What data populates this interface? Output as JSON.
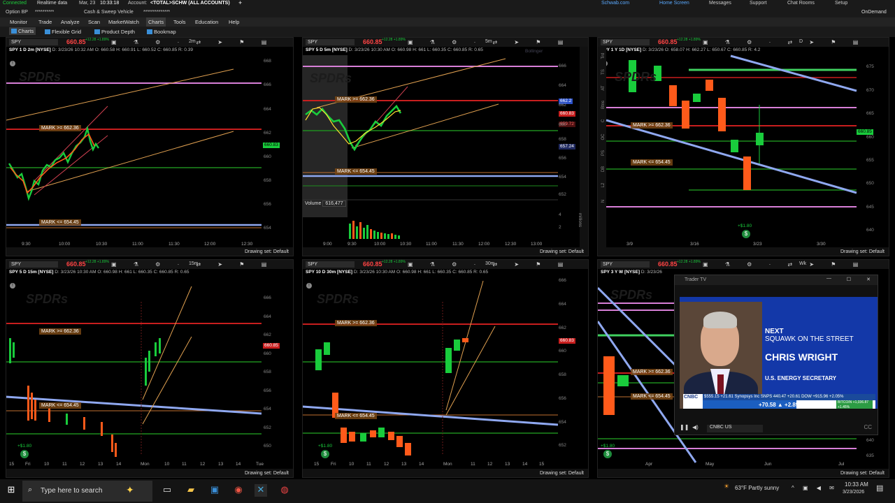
{
  "topbar": {
    "connected": "Connected",
    "realtime": "Realtime data",
    "date": "Mar, 23",
    "time": "10:33:18",
    "account_label": "Account:",
    "account": "<TOTAL>SCHW (ALL ACCOUNTS)",
    "plus": "+",
    "links": [
      "Schwab.com",
      "Home Screen",
      "Messages",
      "Support",
      "Chat Rooms",
      "Setup"
    ]
  },
  "row2": {
    "option_bp": "Option BP",
    "cash_sweep": "Cash & Sweep Vehicle",
    "masked1": "**********",
    "masked2": "**************",
    "ondemand": "OnDemand"
  },
  "menu": [
    "Monitor",
    "Trade",
    "Analyze",
    "Scan",
    "MarketWatch",
    "Charts",
    "Tools",
    "Education",
    "Help"
  ],
  "submenu": [
    "Charts",
    "Flexible Grid",
    "Product Depth",
    "Bookmap"
  ],
  "price": "660.85",
  "chg": "+12.28 +1.89%",
  "drawing_set": "Drawing set: Default",
  "mark_high": "MARK >= 662.36",
  "mark_low": "MARK <= 654.45",
  "panels": [
    {
      "symbol": "SPY",
      "tf": "2m",
      "info": "SPY 1 D 2m [NYSE]",
      "ohlc": "D: 3/23/26 10:32 AM   O: 660.58   H: 660.91   L: 660.52   C: 660.85   R: 0.39",
      "yticks": [
        "668",
        "666",
        "664",
        "662",
        "660",
        "658",
        "656",
        "654"
      ],
      "xticks": [
        "9:30",
        "10:00",
        "10:30",
        "11:00",
        "11:30",
        "12:00",
        "12:30"
      ],
      "tag": "660.83"
    },
    {
      "symbol": "SPY",
      "tf": "5m",
      "info": "SPY 5 D 5m [NYSE]",
      "ohlc": "D: 3/23/26 10:30 AM   O: 660.98   H: 661   L: 660.35   C: 660.85   R: 0.65",
      "yticks": [
        "666",
        "664",
        "662",
        "660",
        "658",
        "656",
        "654",
        "652"
      ],
      "xticks": [
        "9:00",
        "9:30",
        "10:00",
        "10:30",
        "11:00",
        "11:30",
        "12:00",
        "12:30",
        "13:00"
      ],
      "tags": [
        "662.2",
        "660.83",
        "659.72",
        "657.24"
      ],
      "volume_label": "Volume",
      "volume": "616,477",
      "vticks": [
        "4",
        "2"
      ],
      "vunit": "millions",
      "bollinger": "Bollinger"
    },
    {
      "symbol": "SPY",
      "tf": "D",
      "info": "SPY 1 Y 1D [NYSE]",
      "ohlc": "D: 3/23/26   O: 658.07   H: 662.27   L: 650.67   C: 660.85   R: 4.2",
      "yticks": [
        "675",
        "670",
        "665",
        "660",
        "655",
        "650",
        "645",
        "640"
      ],
      "xticks": [
        "3/9",
        "3/16",
        "3/23",
        "3/30"
      ],
      "tag": "660.85",
      "dividend": "+$1.80"
    },
    {
      "symbol": "SPY",
      "tf": "15m",
      "info": "SPY 5 D 15m [NYSE]",
      "ohlc": "D: 3/23/26 10:30 AM   O: 660.98   H: 661   L: 660.35   C: 660.85   R: 0.65",
      "yticks": [
        "666",
        "664",
        "662",
        "660",
        "658",
        "656",
        "654",
        "652",
        "650"
      ],
      "xticks": [
        "15",
        "Fri",
        "10",
        "11",
        "12",
        "13",
        "14",
        "Mon",
        "10",
        "11",
        "12",
        "13",
        "14",
        "Tue"
      ],
      "tag": "660.85",
      "dividend": "+$1.80"
    },
    {
      "symbol": "SPY",
      "tf": "30m",
      "info": "SPY 10 D 30m [NYSE]",
      "ohlc": "D: 3/23/26 10:30 AM   O: 660.98   H: 661   L: 660.35   C: 660.85   R: 0.65",
      "yticks": [
        "666",
        "664",
        "662",
        "660",
        "658",
        "656",
        "654",
        "652"
      ],
      "xticks": [
        "15",
        "Fri",
        "10",
        "11",
        "12",
        "13",
        "14",
        "Mon",
        "11",
        "12",
        "13",
        "14",
        "15"
      ],
      "tag": "660.83",
      "dividend": "+$1.80"
    },
    {
      "symbol": "SPY",
      "tf": "Wk",
      "info": "SPY 3 Y W [NYSE]",
      "ohlc": "D: 3/23/26",
      "yticks": [
        "640",
        "635"
      ],
      "xticks": [
        "Apr",
        "May",
        "Jun",
        "Jul"
      ],
      "dividend": "+$1.80"
    }
  ],
  "sidetabs": [
    "Trd",
    "TS",
    "AT",
    "Btns",
    "C",
    "OC",
    "PS",
    "DB",
    "L2",
    "N"
  ],
  "trader_tv": {
    "title": "Trader TV",
    "next": "NEXT",
    "show": "SQUAWK ON THE STREET",
    "name": "CHRIS WRIGHT",
    "role": "U.S. ENERGY SECRETARY",
    "ticker_top": "$555.15  +21.61     Synopsys Inc SNPS 440.47  +20.61   DOW +915.96 +2.05%",
    "ticker_big": "+70.58   ▲ +2.89%",
    "ticker_small": "BITCOIN +1,036.87 +1.45%",
    "logo": "CNBC",
    "channel": "CNBC US"
  },
  "taskbar": {
    "search": "Type here to search",
    "weather": "63°F  Partly sunny",
    "time": "10:33 AM",
    "date": "3/23/2026"
  },
  "colors": {
    "up": "#19cc3c",
    "down": "#ff5a1a",
    "red_line": "#c81e1e",
    "green_line": "#1e8c1e",
    "magenta": "#d87fd8",
    "blue_trend": "#8fa8f0",
    "orange_trend": "#e0a050"
  }
}
